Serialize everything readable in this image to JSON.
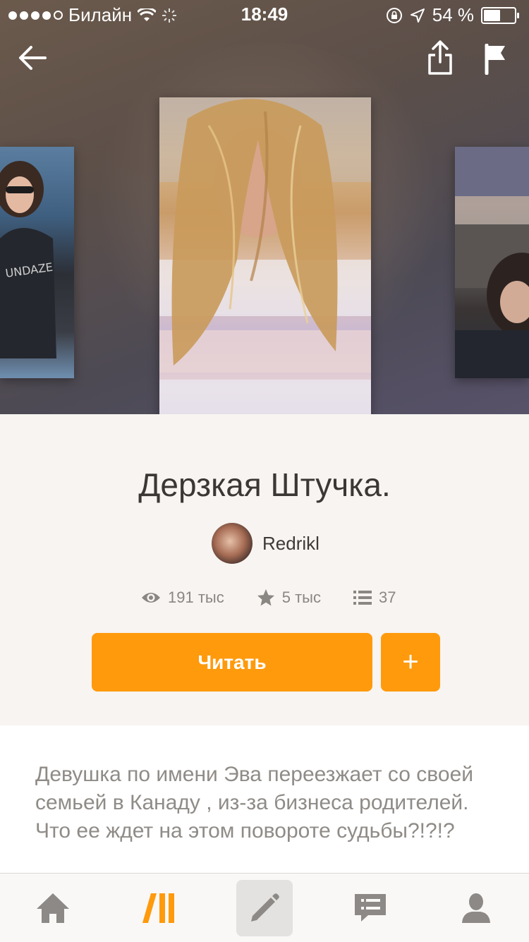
{
  "status_bar": {
    "carrier": "Билайн",
    "time": "18:49",
    "battery": "54 %",
    "battery_level": 0.54
  },
  "story": {
    "title": "Дерзкая Штучка.",
    "author": "Redrikl",
    "views": "191 тыс",
    "stars": "5 тыс",
    "chapters": "37"
  },
  "actions": {
    "read_label": "Читать",
    "add_label": "+"
  },
  "description": "Девушка по имени Эва переезжает со своей семьей в Канаду , из-за бизнеса родителей.\nЧто ее ждет на этом повороте судьбы?!?!?",
  "icons": {
    "back": "arrow-left-icon",
    "share": "share-icon",
    "report": "flag-icon",
    "views": "eye-icon",
    "stars": "star-icon",
    "chapters": "list-icon"
  },
  "tabbar": [
    "home-icon",
    "wattpad-logo-icon",
    "pencil-icon",
    "messages-icon",
    "profile-icon"
  ],
  "colors": {
    "accent": "#ff9a0c",
    "tab_icon": "#8c8986"
  }
}
